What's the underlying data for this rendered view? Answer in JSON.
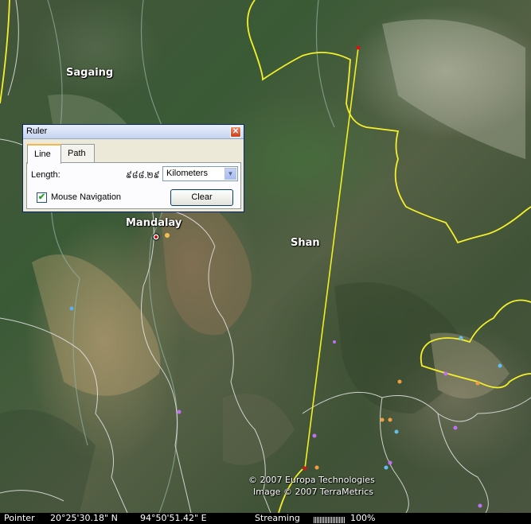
{
  "map": {
    "labels": {
      "sagaing": "Sagaing",
      "mandalay": "Mandalay",
      "shan": "Shan"
    },
    "copyright_lines": [
      "© 2007 Europa Technologies",
      "Image © 2007 TerraMetrics"
    ],
    "colors": {
      "border": "#f5f02a",
      "ruler_line": "#f0f020",
      "ruler_endpoint": "#e01010",
      "subdivision": "#e8e8e8"
    }
  },
  "ruler": {
    "title": "Ruler",
    "close_icon": "close-icon",
    "tabs": [
      {
        "label": "Line",
        "active": true
      },
      {
        "label": "Path",
        "active": false
      }
    ],
    "length_label": "Length:",
    "length_value": "៩៨៨.២៩",
    "unit_selected": "Kilometers",
    "mouse_navigation_label": "Mouse Navigation",
    "mouse_navigation_checked": true,
    "clear_label": "Clear"
  },
  "statusbar": {
    "pointer_label": "Pointer",
    "latitude": "20°25'30.18\" N",
    "longitude": "94°50'51.42\" E",
    "streaming_label": "Streaming",
    "streaming_percent": "100%",
    "streaming_progress": 100
  }
}
